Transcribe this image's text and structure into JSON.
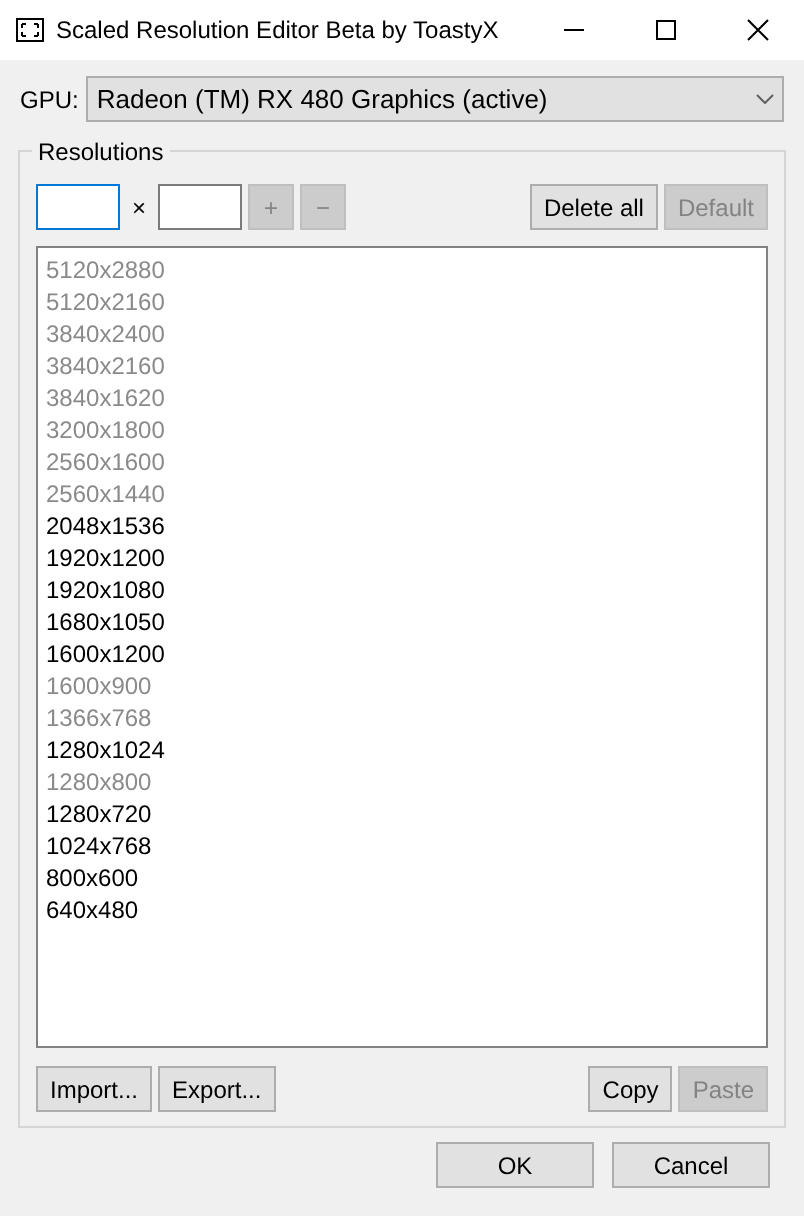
{
  "window": {
    "title": "Scaled Resolution Editor Beta by ToastyX"
  },
  "gpu": {
    "label": "GPU:",
    "value": "Radeon (TM) RX 480 Graphics (active)"
  },
  "resolutions": {
    "title": "Resolutions",
    "separator": "×",
    "controls": [
      {
        "label": "+",
        "disabled": true
      },
      {
        "label": "−",
        "disabled": true
      }
    ],
    "right_controls": [
      {
        "label": "Delete all",
        "disabled": false
      },
      {
        "label": "Default",
        "disabled": true
      }
    ],
    "items": [
      {
        "label": "5120x2880",
        "disabled": true
      },
      {
        "label": "5120x2160",
        "disabled": true
      },
      {
        "label": "3840x2400",
        "disabled": true
      },
      {
        "label": "3840x2160",
        "disabled": true
      },
      {
        "label": "3840x1620",
        "disabled": true
      },
      {
        "label": "3200x1800",
        "disabled": true
      },
      {
        "label": "2560x1600",
        "disabled": true
      },
      {
        "label": "2560x1440",
        "disabled": true
      },
      {
        "label": "2048x1536",
        "disabled": false
      },
      {
        "label": "1920x1200",
        "disabled": false
      },
      {
        "label": "1920x1080",
        "disabled": false
      },
      {
        "label": "1680x1050",
        "disabled": false
      },
      {
        "label": "1600x1200",
        "disabled": false
      },
      {
        "label": "1600x900",
        "disabled": true
      },
      {
        "label": "1366x768",
        "disabled": true
      },
      {
        "label": "1280x1024",
        "disabled": false
      },
      {
        "label": "1280x800",
        "disabled": true
      },
      {
        "label": "1280x720",
        "disabled": false
      },
      {
        "label": "1024x768",
        "disabled": false
      },
      {
        "label": "800x600",
        "disabled": false
      },
      {
        "label": "640x480",
        "disabled": false
      }
    ],
    "left_buttons": [
      {
        "label": "Import...",
        "disabled": false
      },
      {
        "label": "Export...",
        "disabled": false
      }
    ],
    "right_buttons": [
      {
        "label": "Copy",
        "disabled": false
      },
      {
        "label": "Paste",
        "disabled": true
      }
    ]
  },
  "dialog_buttons": [
    {
      "label": "OK",
      "disabled": false
    },
    {
      "label": "Cancel",
      "disabled": false
    }
  ]
}
